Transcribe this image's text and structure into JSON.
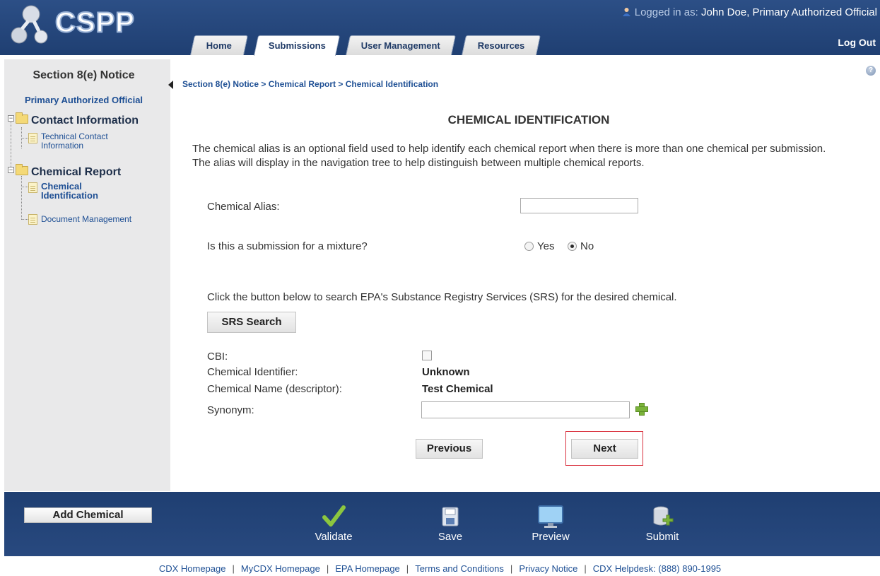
{
  "header": {
    "app_name": "CSPP",
    "login_prefix": "Logged in as:",
    "login_user": "John Doe, Primary Authorized Official",
    "logout_label": "Log Out",
    "tabs": [
      {
        "label": "Home",
        "active": false
      },
      {
        "label": "Submissions",
        "active": true
      },
      {
        "label": "User Management",
        "active": false
      },
      {
        "label": "Resources",
        "active": false
      }
    ]
  },
  "sidebar": {
    "title": "Section 8(e) Notice",
    "subtitle": "Primary Authorized Official",
    "tree": {
      "contact_folder": "Contact Information",
      "technical_contact_line1": "Technical Contact",
      "technical_contact_line2": "Information",
      "chemical_folder": "Chemical Report",
      "chemical_identification_line1": "Chemical",
      "chemical_identification_line2": "Identification",
      "document_management": "Document Management"
    }
  },
  "main": {
    "breadcrumb": "Section 8(e) Notice > Chemical Report > Chemical Identification",
    "title": "CHEMICAL IDENTIFICATION",
    "intro": "The chemical alias is an optional field used to help identify each chemical report when there is more than one chemical per submission. The alias will display in the navigation tree to help distinguish between multiple chemical reports.",
    "chemical_alias_label": "Chemical Alias:",
    "chemical_alias_value": "",
    "mixture_question": "Is this a submission for a mixture?",
    "mixture_yes": "Yes",
    "mixture_no": "No",
    "mixture_selected": "No",
    "srs_instruction": "Click the button below to search EPA's Substance Registry Services (SRS) for the desired chemical.",
    "srs_button": "SRS Search",
    "cbi_label": "CBI:",
    "cbi_checked": false,
    "chemical_identifier_label": "Chemical Identifier:",
    "chemical_identifier_value": "Unknown",
    "chemical_name_label": "Chemical Name (descriptor):",
    "chemical_name_value": "Test Chemical",
    "synonym_label": "Synonym:",
    "synonym_value": "",
    "previous_button": "Previous",
    "next_button": "Next"
  },
  "toolbar": {
    "add_chemical": "Add Chemical",
    "validate": "Validate",
    "save": "Save",
    "preview": "Preview",
    "submit": "Submit"
  },
  "footer": {
    "links": [
      "CDX Homepage",
      "MyCDX Homepage",
      "EPA Homepage",
      "Terms and Conditions",
      "Privacy Notice",
      "CDX Helpdesk: (888) 890-1995"
    ]
  },
  "colors": {
    "header_blue": "#1f3f72",
    "link_blue": "#1e4f94",
    "highlight_red": "#d9323f"
  }
}
